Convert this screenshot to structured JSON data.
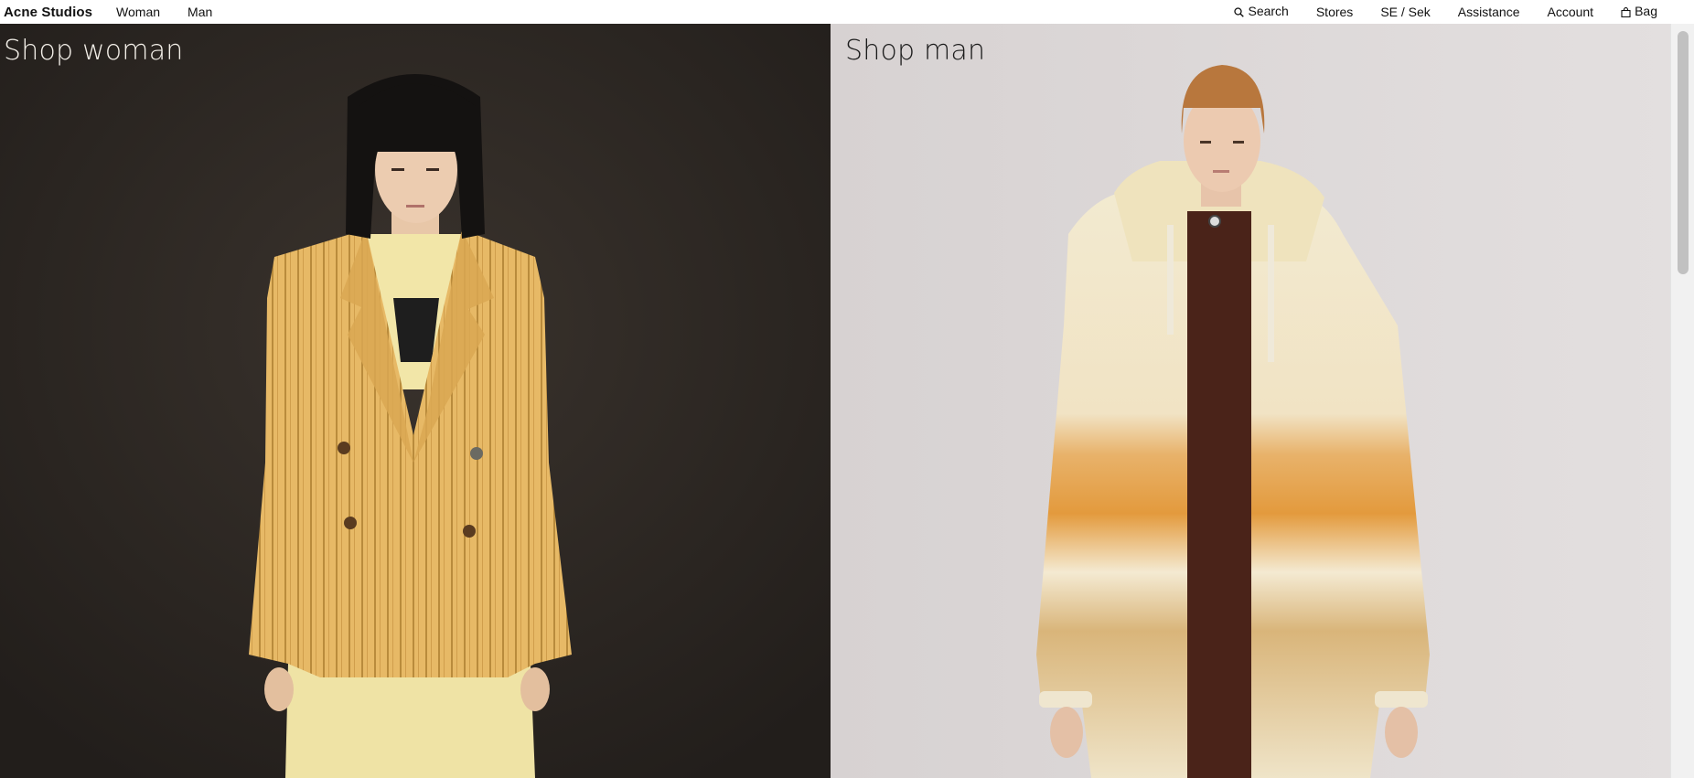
{
  "header": {
    "brand": "Acne Studios",
    "nav_left": [
      "Woman",
      "Man"
    ],
    "search_label": "Search",
    "stores_label": "Stores",
    "locale_label": "SE / Sek",
    "assistance_label": "Assistance",
    "account_label": "Account",
    "bag_label": "Bag"
  },
  "panels": {
    "woman_title": "Shop woman",
    "man_title": "Shop man"
  },
  "icons": {
    "search": "search-icon",
    "bag": "bag-icon"
  },
  "colors": {
    "woman_bg": "#2b2622",
    "man_bg": "#d8d3d3",
    "text": "#111111"
  }
}
